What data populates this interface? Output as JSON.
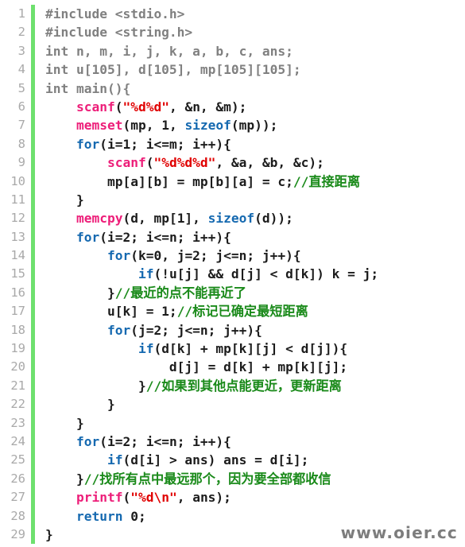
{
  "editor": {
    "title": "c-source-code-listing",
    "language": "c",
    "line_count": 29,
    "colors": {
      "background": "#ffffff",
      "gutter_number": "#a9a9a9",
      "gutter_bar": "#6ee06e",
      "plain_text": "#1c1c1c",
      "preprocessor": "#808080",
      "keyword": "#1569b0",
      "function": "#ed1e79",
      "string": "#e00000",
      "comment": "#1a8a1a",
      "watermark": "#7d7d7d"
    }
  },
  "watermark": {
    "text": "www.oier.cc"
  },
  "lines": [
    {
      "number": "1",
      "text": "#include <stdio.h>",
      "tokens": [
        {
          "t": "#include <stdio.h>",
          "c": "t-pre"
        }
      ]
    },
    {
      "number": "2",
      "text": "#include <string.h>",
      "tokens": [
        {
          "t": "#include <string.h>",
          "c": "t-pre"
        }
      ]
    },
    {
      "number": "3",
      "text": "int n, m, i, j, k, a, b, c, ans;",
      "tokens": [
        {
          "t": "int n, m, i, j, k, a, b, c, ans;",
          "c": "t-pre"
        }
      ]
    },
    {
      "number": "4",
      "text": "int u[105], d[105], mp[105][105];",
      "tokens": [
        {
          "t": "int u[105], d[105], mp[105][105];",
          "c": "t-pre"
        }
      ]
    },
    {
      "number": "5",
      "text": "int main(){",
      "tokens": [
        {
          "t": "int main(){",
          "c": "t-pre"
        }
      ]
    },
    {
      "number": "6",
      "text": "    scanf(\"%d%d\", &n, &m);",
      "tokens": [
        {
          "t": "    ",
          "c": "t-plain"
        },
        {
          "t": "scanf",
          "c": "t-fn"
        },
        {
          "t": "(",
          "c": "t-plain"
        },
        {
          "t": "\"%d%d\"",
          "c": "t-str"
        },
        {
          "t": ", &n, &m);",
          "c": "t-plain"
        }
      ]
    },
    {
      "number": "7",
      "text": "    memset(mp, 1, sizeof(mp));",
      "tokens": [
        {
          "t": "    ",
          "c": "t-plain"
        },
        {
          "t": "memset",
          "c": "t-fn"
        },
        {
          "t": "(mp, 1, ",
          "c": "t-plain"
        },
        {
          "t": "sizeof",
          "c": "t-kw"
        },
        {
          "t": "(mp));",
          "c": "t-plain"
        }
      ]
    },
    {
      "number": "8",
      "text": "    for(i=1; i<=m; i++){",
      "tokens": [
        {
          "t": "    ",
          "c": "t-plain"
        },
        {
          "t": "for",
          "c": "t-kw"
        },
        {
          "t": "(i=1; i<=m; i++){",
          "c": "t-plain"
        }
      ]
    },
    {
      "number": "9",
      "text": "        scanf(\"%d%d%d\", &a, &b, &c);",
      "tokens": [
        {
          "t": "        ",
          "c": "t-plain"
        },
        {
          "t": "scanf",
          "c": "t-fn"
        },
        {
          "t": "(",
          "c": "t-plain"
        },
        {
          "t": "\"%d%d%d\"",
          "c": "t-str"
        },
        {
          "t": ", &a, &b, &c);",
          "c": "t-plain"
        }
      ]
    },
    {
      "number": "10",
      "text": "        mp[a][b] = mp[b][a] = c;//直接距离",
      "tokens": [
        {
          "t": "        mp[a][b] = mp[b][a] = c;",
          "c": "t-plain"
        },
        {
          "t": "//直接距离",
          "c": "t-cmt"
        }
      ]
    },
    {
      "number": "11",
      "text": "    }",
      "tokens": [
        {
          "t": "    }",
          "c": "t-plain"
        }
      ]
    },
    {
      "number": "12",
      "text": "    memcpy(d, mp[1], sizeof(d));",
      "tokens": [
        {
          "t": "    ",
          "c": "t-plain"
        },
        {
          "t": "memcpy",
          "c": "t-fn"
        },
        {
          "t": "(d, mp[1], ",
          "c": "t-plain"
        },
        {
          "t": "sizeof",
          "c": "t-kw"
        },
        {
          "t": "(d));",
          "c": "t-plain"
        }
      ]
    },
    {
      "number": "13",
      "text": "    for(i=2; i<=n; i++){",
      "tokens": [
        {
          "t": "    ",
          "c": "t-plain"
        },
        {
          "t": "for",
          "c": "t-kw"
        },
        {
          "t": "(i=2; i<=n; i++){",
          "c": "t-plain"
        }
      ]
    },
    {
      "number": "14",
      "text": "        for(k=0, j=2; j<=n; j++){",
      "tokens": [
        {
          "t": "        ",
          "c": "t-plain"
        },
        {
          "t": "for",
          "c": "t-kw"
        },
        {
          "t": "(k=0, j=2; j<=n; j++){",
          "c": "t-plain"
        }
      ]
    },
    {
      "number": "15",
      "text": "            if(!u[j] && d[j] < d[k]) k = j;",
      "tokens": [
        {
          "t": "            ",
          "c": "t-plain"
        },
        {
          "t": "if",
          "c": "t-kw"
        },
        {
          "t": "(!u[j] && d[j] < d[k]) k = j;",
          "c": "t-plain"
        }
      ]
    },
    {
      "number": "16",
      "text": "        }//最近的点不能再近了",
      "tokens": [
        {
          "t": "        }",
          "c": "t-plain"
        },
        {
          "t": "//最近的点不能再近了",
          "c": "t-cmt"
        }
      ]
    },
    {
      "number": "17",
      "text": "        u[k] = 1;//标记已确定最短距离",
      "tokens": [
        {
          "t": "        u[k] = 1;",
          "c": "t-plain"
        },
        {
          "t": "//标记已确定最短距离",
          "c": "t-cmt"
        }
      ]
    },
    {
      "number": "18",
      "text": "        for(j=2; j<=n; j++){",
      "tokens": [
        {
          "t": "        ",
          "c": "t-plain"
        },
        {
          "t": "for",
          "c": "t-kw"
        },
        {
          "t": "(j=2; j<=n; j++){",
          "c": "t-plain"
        }
      ]
    },
    {
      "number": "19",
      "text": "            if(d[k] + mp[k][j] < d[j]){",
      "tokens": [
        {
          "t": "            ",
          "c": "t-plain"
        },
        {
          "t": "if",
          "c": "t-kw"
        },
        {
          "t": "(d[k] + mp[k][j] < d[j]){",
          "c": "t-plain"
        }
      ]
    },
    {
      "number": "20",
      "text": "                d[j] = d[k] + mp[k][j];",
      "tokens": [
        {
          "t": "                d[j] = d[k] + mp[k][j];",
          "c": "t-plain"
        }
      ]
    },
    {
      "number": "21",
      "text": "            }//如果到其他点能更近，更新距离",
      "tokens": [
        {
          "t": "            }",
          "c": "t-plain"
        },
        {
          "t": "//如果到其他点能更近，更新距离",
          "c": "t-cmt"
        }
      ]
    },
    {
      "number": "22",
      "text": "        }",
      "tokens": [
        {
          "t": "        }",
          "c": "t-plain"
        }
      ]
    },
    {
      "number": "23",
      "text": "    }",
      "tokens": [
        {
          "t": "    }",
          "c": "t-plain"
        }
      ]
    },
    {
      "number": "24",
      "text": "    for(i=2; i<=n; i++){",
      "tokens": [
        {
          "t": "    ",
          "c": "t-plain"
        },
        {
          "t": "for",
          "c": "t-kw"
        },
        {
          "t": "(i=2; i<=n; i++){",
          "c": "t-plain"
        }
      ]
    },
    {
      "number": "25",
      "text": "        if(d[i] > ans) ans = d[i];",
      "tokens": [
        {
          "t": "        ",
          "c": "t-plain"
        },
        {
          "t": "if",
          "c": "t-kw"
        },
        {
          "t": "(d[i] > ans) ans = d[i];",
          "c": "t-plain"
        }
      ]
    },
    {
      "number": "26",
      "text": "    }//找所有点中最远那个，因为要全部都收信",
      "tokens": [
        {
          "t": "    }",
          "c": "t-plain"
        },
        {
          "t": "//找所有点中最远那个，因为要全部都收信",
          "c": "t-cmt"
        }
      ]
    },
    {
      "number": "27",
      "text": "    printf(\"%d\\n\", ans);",
      "tokens": [
        {
          "t": "    ",
          "c": "t-plain"
        },
        {
          "t": "printf",
          "c": "t-fn"
        },
        {
          "t": "(",
          "c": "t-plain"
        },
        {
          "t": "\"%d\\n\"",
          "c": "t-str"
        },
        {
          "t": ", ans);",
          "c": "t-plain"
        }
      ]
    },
    {
      "number": "28",
      "text": "    return 0;",
      "tokens": [
        {
          "t": "    ",
          "c": "t-plain"
        },
        {
          "t": "return",
          "c": "t-kw"
        },
        {
          "t": " 0;",
          "c": "t-plain"
        }
      ]
    },
    {
      "number": "29",
      "text": "}",
      "tokens": [
        {
          "t": "}",
          "c": "t-plain"
        }
      ]
    }
  ]
}
